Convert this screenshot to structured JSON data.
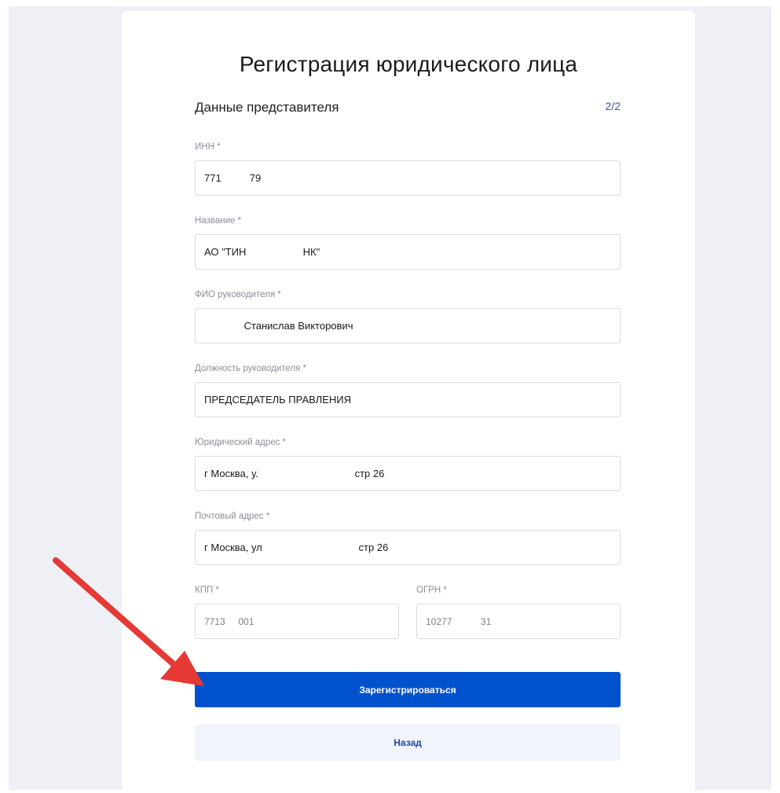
{
  "page": {
    "title": "Регистрация юридического лица",
    "section_title": "Данные представителя",
    "step": "2/2"
  },
  "fields": {
    "inn": {
      "label": "ИНН *",
      "value": "771          79"
    },
    "name": {
      "label": "Название *",
      "value": "АО \"ТИН                    НК\""
    },
    "ceo_fio": {
      "label": "ФИО руководителя *",
      "value": "              Станислав Викторович"
    },
    "ceo_position": {
      "label": "Должность руководителя *",
      "value": "ПРЕДСЕДАТЕЛЬ ПРАВЛЕНИЯ"
    },
    "legal_address": {
      "label": "Юридический адрес *",
      "value": "г Москва, у.                                  стр 26"
    },
    "postal_address": {
      "label": "Почтовый адрес *",
      "value": "г Москва, ул                                  стр 26"
    },
    "kpp": {
      "label": "КПП *",
      "value": "7713     001"
    },
    "ogrn": {
      "label": "ОГРН *",
      "value": "10277           31"
    }
  },
  "buttons": {
    "register": "Зарегистрироваться",
    "back": "Назад"
  },
  "colors": {
    "primary": "#0052cc",
    "secondary_bg": "#f1f4fb",
    "page_bg": "#eef0f6",
    "annotation_arrow": "#e53935"
  }
}
